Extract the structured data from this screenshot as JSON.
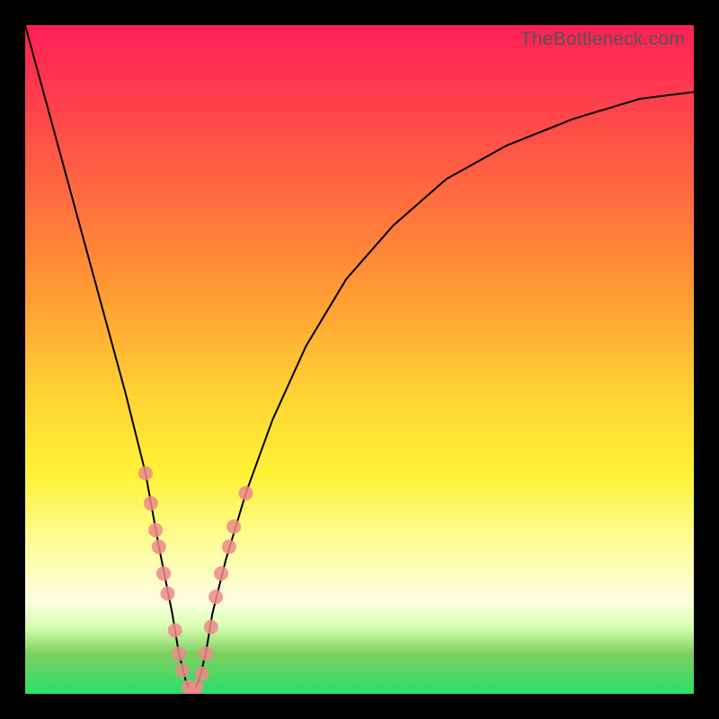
{
  "watermark": "TheBottleneck.com",
  "colors": {
    "frame": "#000000",
    "curve": "#000000",
    "marker": "#ed8a89",
    "gradient_top": "#ff1f55",
    "gradient_bottom": "#29e06a"
  },
  "chart_data": {
    "type": "line",
    "title": "",
    "xlabel": "",
    "ylabel": "",
    "xlim": [
      0,
      100
    ],
    "ylim": [
      0,
      100
    ],
    "annotations": [
      "TheBottleneck.com"
    ],
    "legend_position": "none",
    "grid": false,
    "series": [
      {
        "name": "bottleneck-curve",
        "x": [
          0,
          3,
          6,
          9,
          12,
          15,
          18,
          20,
          22,
          23,
          24,
          25,
          26,
          27,
          28,
          30,
          33,
          37,
          42,
          48,
          55,
          63,
          72,
          82,
          92,
          100
        ],
        "values": [
          100,
          89,
          78,
          67,
          56,
          45,
          33,
          22,
          12,
          6,
          2,
          0,
          2,
          6,
          12,
          20,
          30,
          41,
          52,
          62,
          70,
          77,
          82,
          86,
          89,
          90
        ]
      }
    ],
    "markers": {
      "name": "highlighted-points",
      "x": [
        18.0,
        18.8,
        19.5,
        20.0,
        20.7,
        21.3,
        22.4,
        23.0,
        23.5,
        24.4,
        25.0,
        25.6,
        26.4,
        27.0,
        27.8,
        28.5,
        29.3,
        30.5,
        31.2,
        33.0
      ],
      "values": [
        33.0,
        28.5,
        24.5,
        22.0,
        18.0,
        15.0,
        9.5,
        6.0,
        3.5,
        1.0,
        0.0,
        1.0,
        3.0,
        6.0,
        10.0,
        14.5,
        18.0,
        22.0,
        25.0,
        30.0
      ]
    }
  }
}
